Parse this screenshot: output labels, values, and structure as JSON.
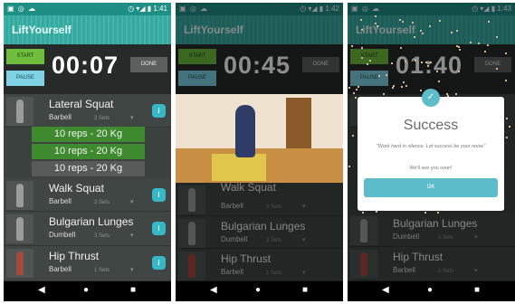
{
  "app": {
    "title": "LiftYourself"
  },
  "status_icons": "▣ ◎ ☁",
  "status_right_icons": "◷ ▾◢ ▮",
  "screens": [
    {
      "clock": "1:41",
      "timer": "00:07"
    },
    {
      "clock": "1:42",
      "timer": "00:45"
    },
    {
      "clock": "1:43",
      "timer": "01:40"
    }
  ],
  "controls": {
    "start": "START",
    "pause": "PAUSE",
    "done": "DONE"
  },
  "exercises": [
    {
      "name": "Lateral Squat",
      "equipment": "Barbell",
      "sets": "3 Sets",
      "chevron": "▾"
    },
    {
      "name": "Walk Squat",
      "equipment": "Barbell",
      "sets": "3 Sets",
      "chevron": "▾"
    },
    {
      "name": "Bulgarian Lunges",
      "equipment": "Dumbell",
      "sets": "3 Sets",
      "chevron": "▾"
    },
    {
      "name": "Hip Thrust",
      "equipment": "Barbell",
      "sets": "1 Sets",
      "chevron": "▾"
    }
  ],
  "reps": [
    {
      "text": "10 reps - 20 Kg",
      "state": "done"
    },
    {
      "text": "10 reps - 20 Kg",
      "state": "done"
    },
    {
      "text": "10 reps - 20 Kg",
      "state": "pending"
    }
  ],
  "info_glyph": "i",
  "nav": {
    "back": "◀",
    "home": "●",
    "recents": "■"
  },
  "dialog": {
    "icon": "✓",
    "title": "Success",
    "message": "\"Work hard in silence. Let success be your noise\"",
    "sub": "We'll see you soon!",
    "ok": "OK"
  },
  "colors": {
    "teal": "#37b0a5",
    "green": "#3e8a2f",
    "info": "#36b8c6",
    "dialog_accent": "#5dbcc9"
  }
}
